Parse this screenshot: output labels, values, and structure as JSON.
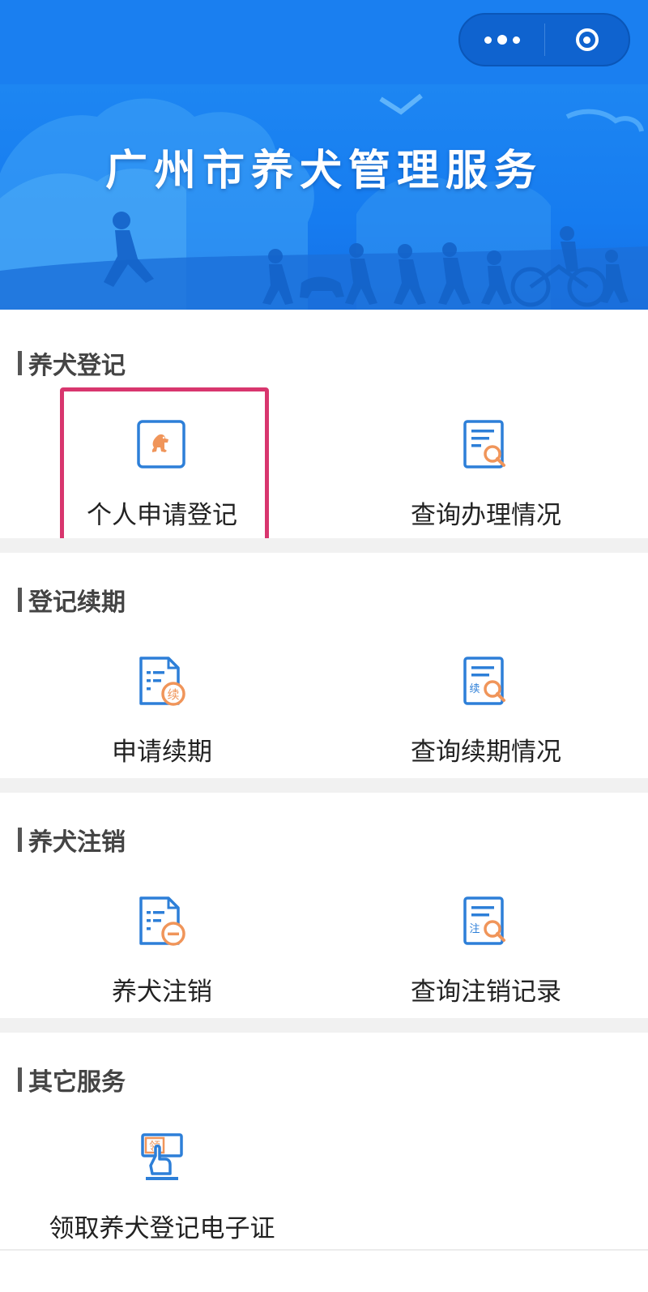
{
  "capsule": {
    "more_icon": "more-dots-icon",
    "close_icon": "target-circle-icon"
  },
  "banner": {
    "title": "广州市养犬管理服务"
  },
  "sections": [
    {
      "title": "养犬登记",
      "items": [
        {
          "label": "个人申请登记",
          "icon": "dog-registration-icon",
          "highlighted": true
        },
        {
          "label": "查询办理情况",
          "icon": "document-search-icon"
        }
      ]
    },
    {
      "title": "登记续期",
      "items": [
        {
          "label": "申请续期",
          "icon": "document-renew-icon",
          "badge": "续"
        },
        {
          "label": "查询续期情况",
          "icon": "renew-search-icon",
          "badge": "续"
        }
      ]
    },
    {
      "title": "养犬注销",
      "items": [
        {
          "label": "养犬注销",
          "icon": "document-cancel-icon"
        },
        {
          "label": "查询注销记录",
          "icon": "cancel-search-icon",
          "badge": "注"
        }
      ]
    },
    {
      "title": "其它服务",
      "items": [
        {
          "label": "领取养犬登记电子证",
          "icon": "claim-certificate-icon",
          "badge": "领"
        }
      ]
    }
  ],
  "colors": {
    "brand_blue": "#1a7ff0",
    "icon_blue": "#2d7fd8",
    "icon_orange": "#f0955a",
    "highlight_pink": "#d8366e"
  }
}
